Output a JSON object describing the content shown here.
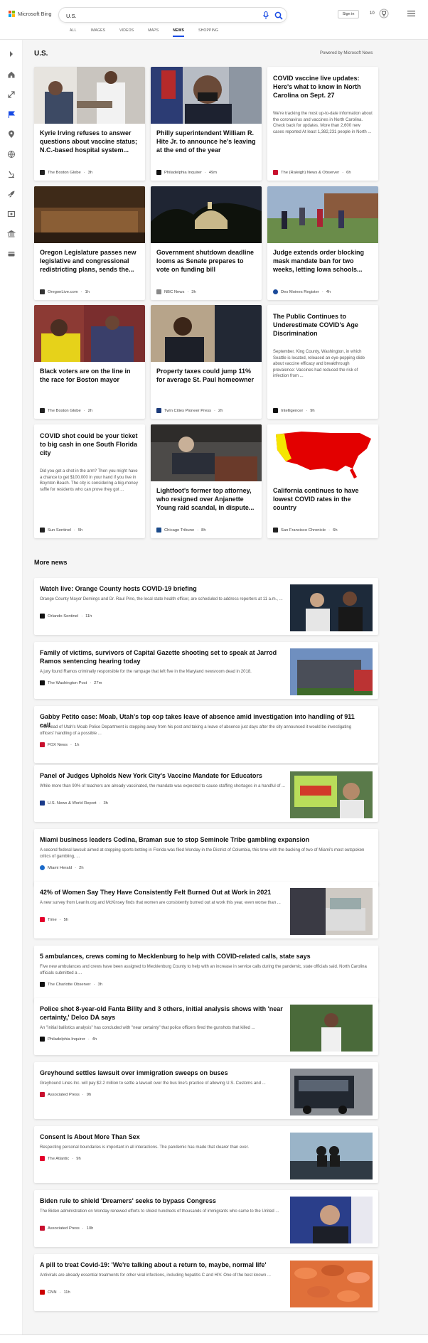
{
  "brand": {
    "logo_text": "Microsoft Bing",
    "colors": [
      "#f25022",
      "#7fba00",
      "#00a4ef",
      "#ffb900"
    ]
  },
  "search": {
    "value": "U.S.",
    "placeholder": ""
  },
  "header": {
    "signin_label": "Sign in",
    "rewards_count": "10"
  },
  "nav": [
    {
      "label": "ALL",
      "active": false
    },
    {
      "label": "IMAGES",
      "active": false
    },
    {
      "label": "VIDEOS",
      "active": false
    },
    {
      "label": "MAPS",
      "active": false
    },
    {
      "label": "NEWS",
      "active": true
    },
    {
      "label": "SHOPPING",
      "active": false
    }
  ],
  "sidebar_icons": [
    "chevron-right-icon",
    "home-icon",
    "expand-icon",
    "flag-icon",
    "location-icon",
    "globe-icon",
    "microscope-icon",
    "rocket-icon",
    "movie-icon",
    "bank-icon",
    "card-icon"
  ],
  "section": {
    "title": "U.S.",
    "powered_by": "Powered by Microsoft News"
  },
  "cards": [
    {
      "title": "Kyrie Irving refuses to answer questions about vaccine status; N.C.-based hospital system...",
      "snippet": "",
      "source": "The Boston Globe",
      "time": "3h"
    },
    {
      "title": "Philly superintendent William R. Hite Jr. to announce he's leaving at the end of the year",
      "snippet": "",
      "source": "Philadelphia Inquirer",
      "time": "49m"
    },
    {
      "title": "COVID vaccine live updates: Here's what to know in North Carolina on Sept. 27",
      "snippet": "We're tracking the most up-to-date information about the coronavirus and vaccines in North Carolina. Check back for updates. More than 2,600 new cases reported At least 1,382,231 people in North ...",
      "source": "The (Raleigh) News & Observer",
      "time": "6h"
    },
    {
      "title": "Oregon Legislature passes new legislative and congressional redistricting plans, sends the...",
      "snippet": "",
      "source": "OregonLive.com",
      "time": "1h"
    },
    {
      "title": "Government shutdown deadline looms as Senate prepares to vote on funding bill",
      "snippet": "",
      "source": "NBC News",
      "time": "3h"
    },
    {
      "title": "Judge extends order blocking mask mandate ban for two weeks, letting Iowa schools...",
      "snippet": "",
      "source": "Des Moines Register",
      "time": "4h"
    },
    {
      "title": "Black voters are on the line in the race for Boston mayor",
      "snippet": "",
      "source": "The Boston Globe",
      "time": "2h"
    },
    {
      "title": "Property taxes could jump 11% for average St. Paul homeowner",
      "snippet": "",
      "source": "Twin Cities Pioneer Press",
      "time": "2h"
    },
    {
      "title": "The Public Continues to Underestimate COVID's Age Discrimination",
      "snippet": "September, King County, Washington, in which Seattle is located, released an eye-popping slide about vaccine efficacy and breakthrough prevalence: Vaccines had reduced the risk of infection from ...",
      "source": "Intelligencer",
      "time": "9h"
    },
    {
      "title": "COVID shot could be your ticket to big cash in one South Florida city",
      "snippet": "Did you get a shot in the arm? Then you might have a chance to get $100,000 in your hand if you live in Boynton Beach. The city is considering a big-money raffle for residents who can prove they got ...",
      "source": "Sun Sentinel",
      "time": "5h"
    },
    {
      "title": "Lightfoot's former top attorney, who resigned over Anjanette Young raid scandal, in dispute...",
      "snippet": "",
      "source": "Chicago Tribune",
      "time": "8h"
    },
    {
      "title": "California continues to have lowest COVID rates in the country",
      "snippet": "",
      "source": "San Francisco Chronicle",
      "time": "6h"
    }
  ],
  "more_news": {
    "title": "More news",
    "items": [
      {
        "title": "Watch live: Orange County hosts COVID-19 briefing",
        "snippet": "Orange County Mayor Demings and Dr. Raul Pino, the local state health officer, are scheduled to address reporters at 11 a.m., ...",
        "source": "Orlando Sentinel",
        "time": "11h"
      },
      {
        "title": "Family of victims, survivors of Capital Gazette shooting set to speak at Jarrod Ramos sentencing hearing today",
        "snippet": "A jury found Ramos criminally responsible for the rampage that left five in the Maryland newsroom dead in 2018.",
        "source": "The Washington Post",
        "time": "27m"
      },
      {
        "title": "Gabby Petito case: Moab, Utah's top cop takes leave of absence amid investigation into handling of 911 call",
        "snippet": "The head of Utah's Moab Police Department is stepping away from his post and taking a leave of absence just days after the city announced it would be investigating officers' handling of a possible ...",
        "source": "FOX News",
        "time": "1h"
      },
      {
        "title": "Panel of Judges Upholds New York City's Vaccine Mandate for Educators",
        "snippet": "While more than 90% of teachers are already vaccinated, the mandate was expected to cause staffing shortages in a handful of ...",
        "source": "U.S. News & World Report",
        "time": "3h"
      },
      {
        "title": "Miami business leaders Codina, Braman sue to stop Seminole Tribe gambling expansion",
        "snippet": "A second federal lawsuit aimed at stopping sports betting in Florida was filed Monday in the District of Columbia, this time with the backing of two of Miami's most outspoken critics of gambling, ...",
        "source": "Miami Herald",
        "time": "2h"
      },
      {
        "title": "42% of Women Say They Have Consistently Felt Burned Out at Work in 2021",
        "snippet": "A new survey from LeanIn.org and McKinsey finds that women are consistently burned out at work this year, even worse than ...",
        "source": "Time",
        "time": "5h"
      },
      {
        "title": "5 ambulances, crews coming to Mecklenburg to help with COVID-related calls, state says",
        "snippet": "Five new ambulances and crews have been assigned to Mecklenburg County to help with an increase in service calls during the pandemic, state officials said. North Carolina officials submitted a ...",
        "source": "The Charlotte Observer",
        "time": "3h"
      },
      {
        "title": "Police shot 8-year-old Fanta Bility and 3 others, initial analysis shows with 'near certainty,' Delco DA says",
        "snippet": "An \"initial ballistics analysis\" has concluded with \"near certainty\" that police officers fired the gunshots that killed ...",
        "source": "Philadelphia Inquirer",
        "time": "4h"
      },
      {
        "title": "Greyhound settles lawsuit over immigration sweeps on buses",
        "snippet": "Greyhound Lines Inc. will pay $2.2 million to settle a lawsuit over the bus line's practice of allowing U.S. Customs and ...",
        "source": "Associated Press",
        "time": "9h"
      },
      {
        "title": "Consent Is About More Than Sex",
        "snippet": "Respecting personal boundaries is important in all interactions. The pandemic has made that clearer than ever.",
        "source": "The Atlantic",
        "time": "9h"
      },
      {
        "title": "Biden rule to shield 'Dreamers' seeks to bypass Congress",
        "snippet": "The Biden administration on Monday renewed efforts to shield hundreds of thousands of immigrants who came to the United ...",
        "source": "Associated Press",
        "time": "10h"
      },
      {
        "title": "A pill to treat Covid-19: 'We're talking about a return to, maybe, normal life'",
        "snippet": "Antivirals are already essential treatments for other viral infections, including hepatitis C and HIV. One of the best known ...",
        "source": "CNN",
        "time": "11h"
      }
    ]
  }
}
